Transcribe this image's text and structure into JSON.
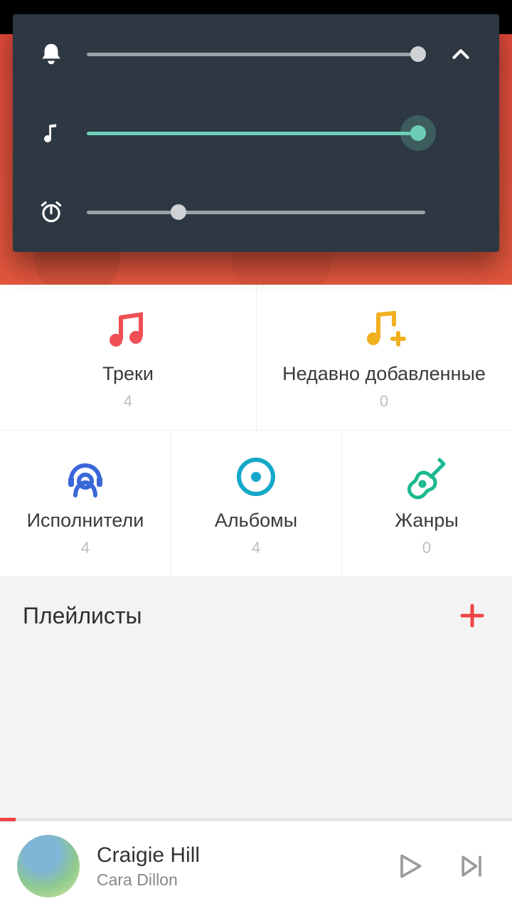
{
  "volume": {
    "notification_pct": 98,
    "media_pct": 98,
    "alarm_pct": 27
  },
  "categories": {
    "tracks": {
      "label": "Треки",
      "count": "4",
      "color": "#ef4f55"
    },
    "recent": {
      "label": "Недавно добавленные",
      "count": "0",
      "color": "#f0b020"
    },
    "artists": {
      "label": "Исполнители",
      "count": "4",
      "color": "#3a68d8"
    },
    "albums": {
      "label": "Альбомы",
      "count": "4",
      "color": "#14a8c9"
    },
    "genres": {
      "label": "Жанры",
      "count": "0",
      "color": "#1bb990"
    }
  },
  "playlists": {
    "title": "Плейлисты"
  },
  "nowplaying": {
    "title": "Craigie Hill",
    "artist": "Cara Dillon",
    "progress_pct": 3
  },
  "colors": {
    "panel": "#2d3842",
    "media_accent": "#6ecfb8",
    "grey_track": "#9aa2a8"
  }
}
